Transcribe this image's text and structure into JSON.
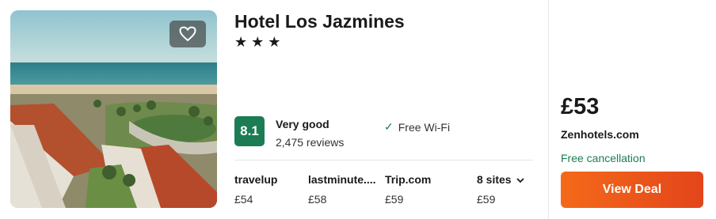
{
  "hotel": {
    "name": "Hotel Los Jazmines",
    "stars": "★★★",
    "star_count": 3,
    "rating": "8.1",
    "rating_label": "Very good",
    "review_count": "2,475 reviews",
    "amenity": "Free Wi-Fi",
    "icons": {
      "favorite": "heart-icon",
      "amenity": "check-icon",
      "expand": "chevron-down-icon"
    }
  },
  "other_sites": [
    {
      "name": "travelup",
      "price": "£54"
    },
    {
      "name": "lastminute....",
      "price": "£58"
    },
    {
      "name": "Trip.com",
      "price": "£59"
    }
  ],
  "more_sites": {
    "label": "8 sites",
    "price": "£59"
  },
  "deal": {
    "price": "£53",
    "provider": "Zenhotels.com",
    "cancellation": "Free cancellation",
    "button_label": "View Deal"
  },
  "colors": {
    "rating_badge": "#1c7c54",
    "cta": "#f05a1a",
    "cancellation": "#1c7c54"
  }
}
